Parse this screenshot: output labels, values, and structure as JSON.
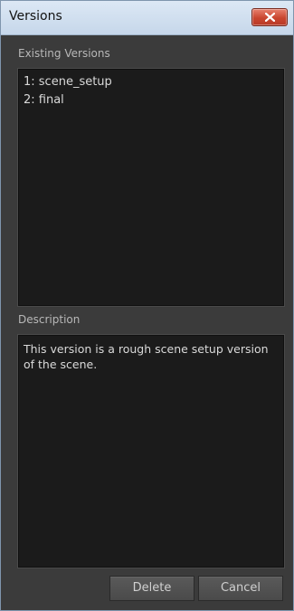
{
  "window": {
    "title": "Versions"
  },
  "existing_versions": {
    "label": "Existing Versions",
    "items": [
      {
        "label": "1: scene_setup"
      },
      {
        "label": "2: final"
      }
    ]
  },
  "description": {
    "label": "Description",
    "text": "This version is a rough scene setup version of the scene."
  },
  "buttons": {
    "delete_label": "Delete",
    "cancel_label": "Cancel"
  },
  "colors": {
    "panel_bg": "#1b1b1b",
    "window_bg": "#3b3b3b",
    "close_button": "#c9452f"
  },
  "icons": {
    "close": "close-icon"
  }
}
